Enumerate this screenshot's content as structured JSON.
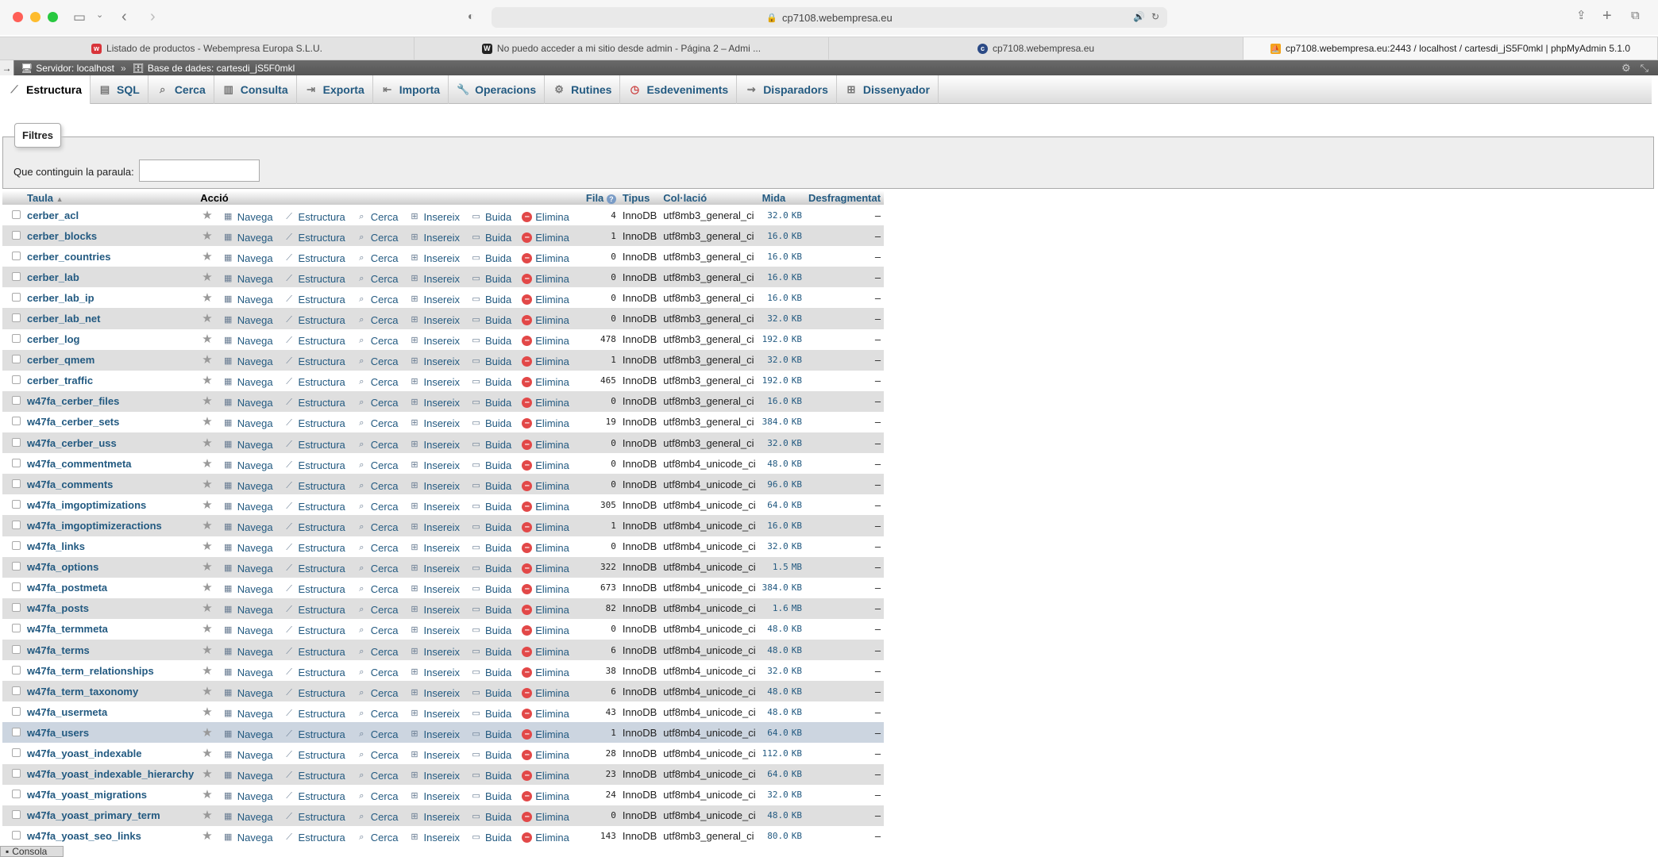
{
  "browser": {
    "url": "cp7108.webempresa.eu",
    "colors": {
      "close": "#ff5f57",
      "minimize": "#febc2e",
      "maximize": "#28c840"
    }
  },
  "tabs": [
    {
      "label": "Listado de productos - Webempresa Europa S.L.U.",
      "icon": "webempresa-favicon"
    },
    {
      "label": "No puedo acceder a mi sitio desde admin - Página 2 – Admi ...",
      "icon": "wordpress-favicon"
    },
    {
      "label": "cp7108.webempresa.eu",
      "icon": "cpanel-favicon"
    },
    {
      "label": "cp7108.webempresa.eu:2443 / localhost / cartesdi_jS5F0mkl | phpMyAdmin 5.1.0",
      "icon": "phpmyadmin-favicon"
    }
  ],
  "breadcrumb": {
    "server": "Servidor: localhost",
    "separator": "»",
    "database": "Base de dades: cartesdi_jS5F0mkl"
  },
  "menu": [
    {
      "label": "Estructura",
      "icon": "structure-icon",
      "active": true
    },
    {
      "label": "SQL",
      "icon": "sql-icon"
    },
    {
      "label": "Cerca",
      "icon": "search-icon"
    },
    {
      "label": "Consulta",
      "icon": "query-icon"
    },
    {
      "label": "Exporta",
      "icon": "export-icon"
    },
    {
      "label": "Importa",
      "icon": "import-icon"
    },
    {
      "label": "Operacions",
      "icon": "operations-icon"
    },
    {
      "label": "Rutines",
      "icon": "routines-icon"
    },
    {
      "label": "Esdeveniments",
      "icon": "events-icon"
    },
    {
      "label": "Disparadors",
      "icon": "triggers-icon"
    },
    {
      "label": "Dissenyador",
      "icon": "designer-icon"
    }
  ],
  "filters": {
    "legend": "Filtres",
    "label": "Que continguin la paraula:",
    "value": ""
  },
  "table": {
    "headers": {
      "table": "Taula",
      "action": "Acció",
      "rows": "Fila",
      "type": "Tipus",
      "collation": "Col·lació",
      "size": "Mida",
      "overhead": "Desfragmentat"
    },
    "actions": {
      "browse": "Navega",
      "structure": "Estructura",
      "search": "Cerca",
      "insert": "Insereix",
      "empty": "Buida",
      "drop": "Elimina"
    },
    "rows": [
      {
        "name": "cerber_acl",
        "rows": "4",
        "type": "InnoDB",
        "collation": "utf8mb3_general_ci",
        "size": "32.0",
        "unit": "KB",
        "overhead": "–"
      },
      {
        "name": "cerber_blocks",
        "rows": "1",
        "type": "InnoDB",
        "collation": "utf8mb3_general_ci",
        "size": "16.0",
        "unit": "KB",
        "overhead": "–"
      },
      {
        "name": "cerber_countries",
        "rows": "0",
        "type": "InnoDB",
        "collation": "utf8mb3_general_ci",
        "size": "16.0",
        "unit": "KB",
        "overhead": "–"
      },
      {
        "name": "cerber_lab",
        "rows": "0",
        "type": "InnoDB",
        "collation": "utf8mb3_general_ci",
        "size": "16.0",
        "unit": "KB",
        "overhead": "–"
      },
      {
        "name": "cerber_lab_ip",
        "rows": "0",
        "type": "InnoDB",
        "collation": "utf8mb3_general_ci",
        "size": "16.0",
        "unit": "KB",
        "overhead": "–"
      },
      {
        "name": "cerber_lab_net",
        "rows": "0",
        "type": "InnoDB",
        "collation": "utf8mb3_general_ci",
        "size": "32.0",
        "unit": "KB",
        "overhead": "–"
      },
      {
        "name": "cerber_log",
        "rows": "478",
        "type": "InnoDB",
        "collation": "utf8mb3_general_ci",
        "size": "192.0",
        "unit": "KB",
        "overhead": "–"
      },
      {
        "name": "cerber_qmem",
        "rows": "1",
        "type": "InnoDB",
        "collation": "utf8mb3_general_ci",
        "size": "32.0",
        "unit": "KB",
        "overhead": "–"
      },
      {
        "name": "cerber_traffic",
        "rows": "465",
        "type": "InnoDB",
        "collation": "utf8mb3_general_ci",
        "size": "192.0",
        "unit": "KB",
        "overhead": "–"
      },
      {
        "name": "w47fa_cerber_files",
        "rows": "0",
        "type": "InnoDB",
        "collation": "utf8mb3_general_ci",
        "size": "16.0",
        "unit": "KB",
        "overhead": "–"
      },
      {
        "name": "w47fa_cerber_sets",
        "rows": "19",
        "type": "InnoDB",
        "collation": "utf8mb3_general_ci",
        "size": "384.0",
        "unit": "KB",
        "overhead": "–"
      },
      {
        "name": "w47fa_cerber_uss",
        "rows": "0",
        "type": "InnoDB",
        "collation": "utf8mb3_general_ci",
        "size": "32.0",
        "unit": "KB",
        "overhead": "–"
      },
      {
        "name": "w47fa_commentmeta",
        "rows": "0",
        "type": "InnoDB",
        "collation": "utf8mb4_unicode_ci",
        "size": "48.0",
        "unit": "KB",
        "overhead": "–"
      },
      {
        "name": "w47fa_comments",
        "rows": "0",
        "type": "InnoDB",
        "collation": "utf8mb4_unicode_ci",
        "size": "96.0",
        "unit": "KB",
        "overhead": "–"
      },
      {
        "name": "w47fa_imgoptimizations",
        "rows": "305",
        "type": "InnoDB",
        "collation": "utf8mb4_unicode_ci",
        "size": "64.0",
        "unit": "KB",
        "overhead": "–"
      },
      {
        "name": "w47fa_imgoptimizeractions",
        "rows": "1",
        "type": "InnoDB",
        "collation": "utf8mb4_unicode_ci",
        "size": "16.0",
        "unit": "KB",
        "overhead": "–"
      },
      {
        "name": "w47fa_links",
        "rows": "0",
        "type": "InnoDB",
        "collation": "utf8mb4_unicode_ci",
        "size": "32.0",
        "unit": "KB",
        "overhead": "–"
      },
      {
        "name": "w47fa_options",
        "rows": "322",
        "type": "InnoDB",
        "collation": "utf8mb4_unicode_ci",
        "size": "1.5",
        "unit": "MB",
        "overhead": "–"
      },
      {
        "name": "w47fa_postmeta",
        "rows": "673",
        "type": "InnoDB",
        "collation": "utf8mb4_unicode_ci",
        "size": "384.0",
        "unit": "KB",
        "overhead": "–"
      },
      {
        "name": "w47fa_posts",
        "rows": "82",
        "type": "InnoDB",
        "collation": "utf8mb4_unicode_ci",
        "size": "1.6",
        "unit": "MB",
        "overhead": "–"
      },
      {
        "name": "w47fa_termmeta",
        "rows": "0",
        "type": "InnoDB",
        "collation": "utf8mb4_unicode_ci",
        "size": "48.0",
        "unit": "KB",
        "overhead": "–"
      },
      {
        "name": "w47fa_terms",
        "rows": "6",
        "type": "InnoDB",
        "collation": "utf8mb4_unicode_ci",
        "size": "48.0",
        "unit": "KB",
        "overhead": "–"
      },
      {
        "name": "w47fa_term_relationships",
        "rows": "38",
        "type": "InnoDB",
        "collation": "utf8mb4_unicode_ci",
        "size": "32.0",
        "unit": "KB",
        "overhead": "–"
      },
      {
        "name": "w47fa_term_taxonomy",
        "rows": "6",
        "type": "InnoDB",
        "collation": "utf8mb4_unicode_ci",
        "size": "48.0",
        "unit": "KB",
        "overhead": "–"
      },
      {
        "name": "w47fa_usermeta",
        "rows": "43",
        "type": "InnoDB",
        "collation": "utf8mb4_unicode_ci",
        "size": "48.0",
        "unit": "KB",
        "overhead": "–"
      },
      {
        "name": "w47fa_users",
        "rows": "1",
        "type": "InnoDB",
        "collation": "utf8mb4_unicode_ci",
        "size": "64.0",
        "unit": "KB",
        "overhead": "–",
        "highlight": true
      },
      {
        "name": "w47fa_yoast_indexable",
        "rows": "28",
        "type": "InnoDB",
        "collation": "utf8mb4_unicode_ci",
        "size": "112.0",
        "unit": "KB",
        "overhead": "–"
      },
      {
        "name": "w47fa_yoast_indexable_hierarchy",
        "rows": "23",
        "type": "InnoDB",
        "collation": "utf8mb4_unicode_ci",
        "size": "64.0",
        "unit": "KB",
        "overhead": "–"
      },
      {
        "name": "w47fa_yoast_migrations",
        "rows": "24",
        "type": "InnoDB",
        "collation": "utf8mb4_unicode_ci",
        "size": "32.0",
        "unit": "KB",
        "overhead": "–"
      },
      {
        "name": "w47fa_yoast_primary_term",
        "rows": "0",
        "type": "InnoDB",
        "collation": "utf8mb4_unicode_ci",
        "size": "48.0",
        "unit": "KB",
        "overhead": "–"
      },
      {
        "name": "w47fa_yoast_seo_links",
        "rows": "143",
        "type": "InnoDB",
        "collation": "utf8mb3_general_ci",
        "size": "80.0",
        "unit": "KB",
        "overhead": "–"
      }
    ]
  },
  "console": {
    "label": "Consola"
  }
}
